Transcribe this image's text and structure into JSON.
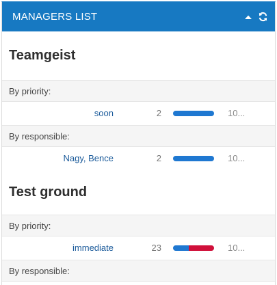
{
  "header": {
    "title": "MANAGERS LIST",
    "collapse_icon": "caret-up-icon",
    "refresh_icon": "refresh-icon",
    "color": "#1779c2"
  },
  "colors": {
    "bar_blue": "#1f78d1",
    "bar_red": "#d0103a"
  },
  "projects": [
    {
      "title": "Teamgeist",
      "groups": [
        {
          "label": "By priority:",
          "rows": [
            {
              "name": "soon",
              "count": "2",
              "total": "10...",
              "fractions": [
                1.0,
                0.0
              ]
            }
          ]
        },
        {
          "label": "By responsible:",
          "rows": [
            {
              "name": "Nagy, Bence",
              "count": "2",
              "total": "10...",
              "fractions": [
                1.0,
                0.0
              ]
            }
          ]
        }
      ]
    },
    {
      "title": "Test ground",
      "groups": [
        {
          "label": "By priority:",
          "rows": [
            {
              "name": "immediate",
              "count": "23",
              "total": "10...",
              "fractions": [
                0.38,
                0.62
              ]
            }
          ]
        },
        {
          "label": "By responsible:",
          "rows": []
        }
      ]
    }
  ]
}
